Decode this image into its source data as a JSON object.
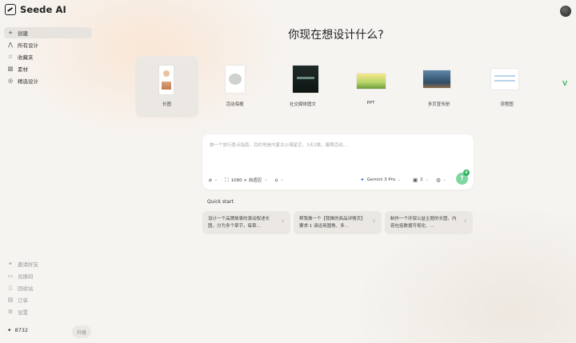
{
  "app": {
    "name": "Seede AI"
  },
  "sidebar": {
    "items": [
      {
        "label": "创建",
        "icon": "plus-icon",
        "glyph": "+",
        "active": true
      },
      {
        "label": "所有设计",
        "icon": "layers-icon",
        "glyph": "⋀",
        "active": false
      },
      {
        "label": "收藏夹",
        "icon": "star-icon",
        "glyph": "☆",
        "active": false
      },
      {
        "label": "素材",
        "icon": "image-icon",
        "glyph": "▨",
        "active": false
      },
      {
        "label": "精选设计",
        "icon": "compass-icon",
        "glyph": "◎",
        "active": false
      }
    ],
    "bottom_items": [
      {
        "label": "邀请好友",
        "icon": "link-icon",
        "glyph": "⚭"
      },
      {
        "label": "兑换码",
        "icon": "ticket-icon",
        "glyph": "▭"
      },
      {
        "label": "回收站",
        "icon": "trash-icon",
        "glyph": "▯"
      },
      {
        "label": "订单",
        "icon": "receipt-icon",
        "glyph": "▤"
      },
      {
        "label": "设置",
        "icon": "gear-icon",
        "glyph": "⚙"
      }
    ],
    "credits": "8732",
    "upgrade_label": "升级"
  },
  "main": {
    "title": "你现在想设计什么?",
    "templates": [
      {
        "label": "长图",
        "selected": true
      },
      {
        "label": "活动海报",
        "selected": false
      },
      {
        "label": "社交媒体图文",
        "selected": false
      },
      {
        "label": "PPT",
        "selected": false
      },
      {
        "label": "多页宣传册",
        "selected": false
      },
      {
        "label": "流程图",
        "selected": false
      }
    ],
    "prompt": {
      "placeholder": "做一个旅行景点指南，目的地是内蒙古沙漠星空，3天2晚，暑期活动...",
      "value": "",
      "size_label": "1080 × 自适应",
      "model_label": "Gemini 3 Pro",
      "count_label": "2",
      "send_badge": "0"
    },
    "quick_start": {
      "title": "Quick start",
      "items": [
        {
          "text": "设计一个品牌故事的滚动叙述长图，分为多个章节，每章..."
        },
        {
          "text": "帮我做一个【我推的商品详情页】要求:1 请运用圆角、多..."
        },
        {
          "text": "制作一个环保公益主题的长图，内容包括数据可视化、..."
        }
      ]
    }
  },
  "colors": {
    "accent_green": "#2fb35e",
    "send_button": "#7fd6a0",
    "selected_bg": "#ebe8e4"
  }
}
